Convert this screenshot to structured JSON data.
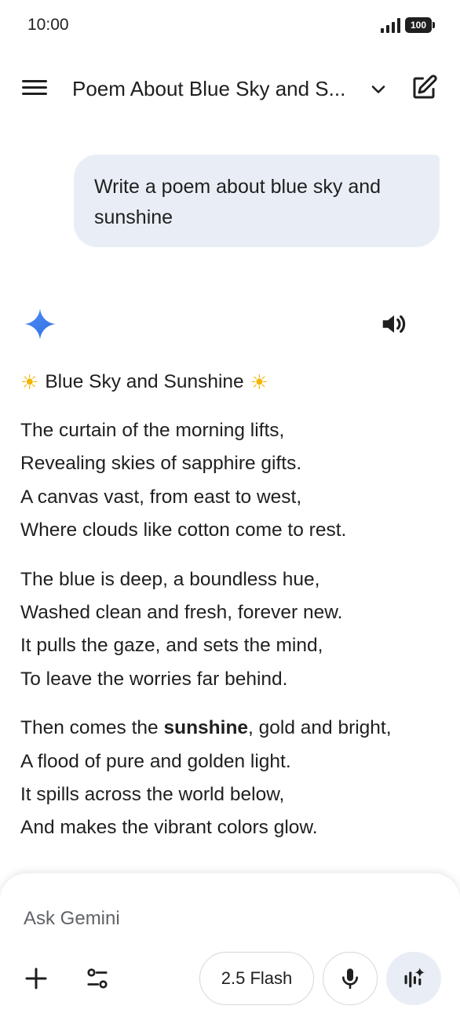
{
  "status": {
    "time": "10:00",
    "battery": "100"
  },
  "header": {
    "title": "Poem About Blue Sky and S..."
  },
  "user_message": {
    "text": "Write a poem about blue sky and sunshine"
  },
  "response": {
    "title": "Blue Sky and Sunshine",
    "stanza1": {
      "line1": "The curtain of the morning lifts,",
      "line2": "Revealing skies of sapphire gifts.",
      "line3": "A canvas vast, from east to west,",
      "line4": "Where clouds like cotton come to rest."
    },
    "stanza2": {
      "line1": "The blue is deep, a boundless hue,",
      "line2": "Washed clean and fresh, forever new.",
      "line3": "It pulls the gaze, and sets the mind,",
      "line4": "To leave the worries far behind."
    },
    "stanza3": {
      "line1_pre": "Then comes the ",
      "line1_bold": "sunshine",
      "line1_post": ", gold and bright,",
      "line2": "A flood of pure and golden light.",
      "line3": "It spills across the world below,",
      "line4": "And makes the vibrant colors glow."
    }
  },
  "input": {
    "placeholder": "Ask Gemini",
    "model_label": "2.5 Flash"
  },
  "colors": {
    "user_bubble": "#e9eef6",
    "gemini_blue": "#3b82f6",
    "sun": "#f5b400"
  },
  "icons": {
    "menu": "menu-icon",
    "chevron": "chevron-down-icon",
    "edit": "edit-icon",
    "gemini": "gemini-sparkle-icon",
    "speaker": "speaker-icon",
    "plus": "plus-icon",
    "tools": "tools-icon",
    "mic": "microphone-icon",
    "live": "live-icon"
  }
}
